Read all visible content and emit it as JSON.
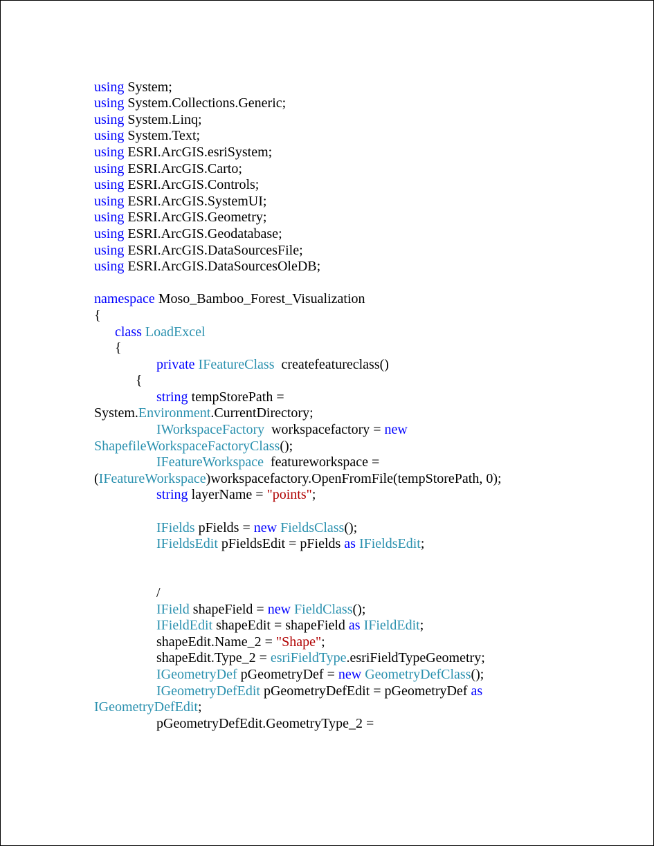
{
  "code": {
    "usings": [
      "System",
      "System.Collections.Generic",
      "System.Linq",
      "System.Text",
      "ESRI.ArcGIS.esriSystem",
      "ESRI.ArcGIS.Carto",
      "ESRI.ArcGIS.Controls",
      "ESRI.ArcGIS.SystemUI",
      "ESRI.ArcGIS.Geometry",
      "ESRI.ArcGIS.Geodatabase",
      "ESRI.ArcGIS.DataSourcesFile",
      "ESRI.ArcGIS.DataSourcesOleDB"
    ],
    "kw_using": "using",
    "kw_namespace": "namespace",
    "namespace_name": "Moso_Bamboo_Forest_Visualization",
    "kw_class": "class",
    "class_name": "LoadExcel",
    "kw_private": "private",
    "ret_type": "IFeatureClass",
    "method_name": "createfeatureclass()",
    "kw_string": "string",
    "tempStorePath_decl": "tempStorePath =",
    "sys": "System.",
    "env": "Environment",
    "curdir": ".CurrentDirectory;",
    "iwsf": "IWorkspaceFactory",
    "wsf_decl": "workspacefactory =",
    "kw_new": "new",
    "shpwfc": "ShapefileWorkspaceFactoryClass",
    "call_close": "();",
    "ifw": "IFeatureWorkspace",
    "fw_decl": "featureworkspace =",
    "cast_open": "(",
    "cast_close": ")workspacefactory.OpenFromFile(tempStorePath, 0);",
    "layerName_decl": "layerName =",
    "layerName_val": "\"points\"",
    "semi": ";",
    "ifields": "IFields",
    "pfields_decl": "pFields =",
    "fieldsclass": "FieldsClass",
    "ifieldsedit": "IFieldsEdit",
    "pfieldsedit_decl": "pFieldsEdit = pFields",
    "kw_as": "as",
    "comment_slash": "/",
    "ifield": "IField",
    "shapefield_decl": "shapeField =",
    "fieldclass": "FieldClass",
    "ifieldedit": "IFieldEdit",
    "shapeedit_decl": "shapeEdit = shapeField",
    "shapename": "shapeEdit.Name_2 =",
    "shapename_val": "\"Shape\"",
    "shapetype": "shapeEdit.Type_2 =",
    "esrifieldtype": "esriFieldType",
    "esrigeom": ".esriFieldTypeGeometry;",
    "igeomdef": "IGeometryDef",
    "pgeomdef_decl": "pGeometryDef =",
    "geomdefclass": "GeometryDefClass",
    "igeomdefedit": "IGeometryDefEdit",
    "pgeomdefedit_decl": "pGeometryDefEdit = pGeometryDef",
    "geomtype_line": "pGeometryDefEdit.GeometryType_2 ="
  }
}
